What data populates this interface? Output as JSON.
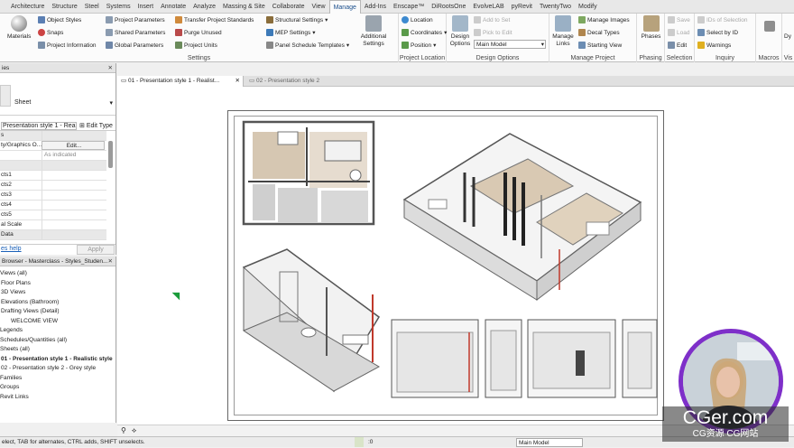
{
  "ribbon_tabs": [
    "Architecture",
    "Structure",
    "Steel",
    "Systems",
    "Insert",
    "Annotate",
    "Analyze",
    "Massing & Site",
    "Collaborate",
    "View",
    "Manage",
    "Add-Ins",
    "Enscape™",
    "DiRootsOne",
    "EvolveLAB",
    "pyRevit",
    "TwentyTwo",
    "Modify"
  ],
  "active_tab": "Manage",
  "settings": {
    "materials": "Materials",
    "object_styles": "Object Styles",
    "snaps": "Snaps",
    "project_information": "Project Information",
    "project_parameters": "Project Parameters",
    "shared_parameters": "Shared Parameters",
    "global_parameters": "Global Parameters",
    "transfer_project_standards": "Transfer Project Standards",
    "purge_unused": "Purge Unused",
    "project_units": "Project Units",
    "structural_settings": "Structural Settings",
    "mep_settings": "MEP Settings",
    "panel_schedule_templates": "Panel Schedule Templates",
    "additional_settings": "Additional Settings",
    "label": "Settings"
  },
  "project_location": {
    "location": "Location",
    "coordinates": "Coordinates",
    "position": "Position",
    "label": "Project Location"
  },
  "design_options": {
    "design_options": "Design Options",
    "add_to_set": "Add to Set",
    "pick_to_edit": "Pick to Edit",
    "main_model": "Main Model",
    "label": "Design Options"
  },
  "manage_project": {
    "manage_links": "Manage Links",
    "manage_images": "Manage Images",
    "decal_types": "Decal Types",
    "starting_view": "Starting View",
    "label": "Manage Project"
  },
  "phasing": {
    "phases": "Phases",
    "label": "Phasing"
  },
  "selection": {
    "save": "Save",
    "load": "Load",
    "edit": "Edit",
    "label": "Selection"
  },
  "inquiry": {
    "ids_of_selection": "IDs of Selection",
    "select_by_id": "Select by ID",
    "warnings": "Warnings",
    "label": "Inquiry"
  },
  "macros": {
    "macros": "Macros",
    "label": "Macros"
  },
  "visual_programming": {
    "dynamo": "Dy",
    "label": "Vis"
  },
  "properties": {
    "title": "ies",
    "type_name": "Sheet",
    "instance": "Presentation style 1 - Realis",
    "edit_type": "Edit Type",
    "rows": [
      {
        "label": "s",
        "value": ""
      },
      {
        "label": "ty/Graphics O...",
        "value": "Edit..."
      },
      {
        "label": "",
        "value": "As indicated"
      },
      {
        "label": "",
        "value": ""
      },
      {
        "label": "cts1",
        "value": ""
      },
      {
        "label": "cts2",
        "value": ""
      },
      {
        "label": "cts3",
        "value": ""
      },
      {
        "label": "cts4",
        "value": ""
      },
      {
        "label": "cts5",
        "value": ""
      },
      {
        "label": "al Scale",
        "value": ""
      },
      {
        "label": "Data",
        "value": ""
      }
    ],
    "help": "es help",
    "apply": "Apply"
  },
  "browser": {
    "title": "Browser - Masterclass - Styles_Studen...",
    "items": [
      {
        "label": "Views (all)",
        "indent": 0,
        "bold": false
      },
      {
        "label": "Floor Plans",
        "indent": 1,
        "bold": false
      },
      {
        "label": "3D Views",
        "indent": 1,
        "bold": false
      },
      {
        "label": "Elevations (Bathroom)",
        "indent": 1,
        "bold": false
      },
      {
        "label": "Drafting Views (Detail)",
        "indent": 1,
        "bold": false
      },
      {
        "label": "WELCOME VIEW",
        "indent": 2,
        "bold": false
      },
      {
        "label": "Legends",
        "indent": 0,
        "bold": false
      },
      {
        "label": "Schedules/Quantities (all)",
        "indent": 0,
        "bold": false
      },
      {
        "label": "Sheets (all)",
        "indent": 0,
        "bold": false
      },
      {
        "label": "01 - Presentation style 1 - Realistic style",
        "indent": 1,
        "bold": true
      },
      {
        "label": "02 - Presentation style 2 - Grey style",
        "indent": 1,
        "bold": false
      },
      {
        "label": "Families",
        "indent": 0,
        "bold": false
      },
      {
        "label": "Groups",
        "indent": 0,
        "bold": false
      },
      {
        "label": "Revit Links",
        "indent": 0,
        "bold": false
      }
    ]
  },
  "doc_tabs": [
    {
      "label": "01 - Presentation style 1 - Realist...",
      "active": true
    },
    {
      "label": "02 - Presentation style 2",
      "active": false
    }
  ],
  "status": {
    "text": "elect, TAB for alternates, CTRL adds, SHIFT unselects.",
    "model": "Main Model",
    "zero": ":0"
  },
  "brand": {
    "name": "CGer.com",
    "sub": "CG资源  CG网站"
  },
  "colors": {
    "accent": "#1a4e8c",
    "avatar_ring": "#7e2fc9",
    "floor": "#d6c7b2",
    "selection_red": "#c0392b"
  }
}
